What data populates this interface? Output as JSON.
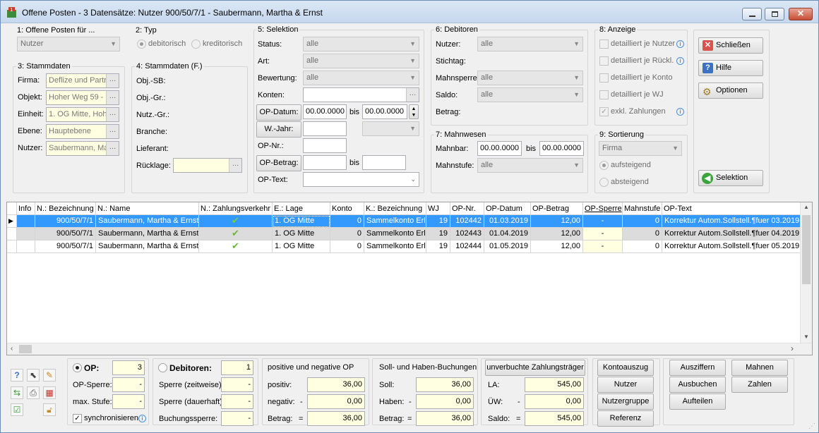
{
  "window": {
    "title": "Offene Posten - 3 Datensätze:  Nutzer 900/50/7/1 - Saubermann, Martha & Ernst",
    "minimize_label": "▬",
    "maximize_label": "▢",
    "close_label": "✕"
  },
  "g1": {
    "title": "1: Offene Posten für ...",
    "value": "Nutzer"
  },
  "g2": {
    "title": "2: Typ",
    "opt1": "debitorisch",
    "opt2": "kreditorisch"
  },
  "g3": {
    "title": "3: Stammdaten",
    "rows": [
      {
        "label": "Firma:",
        "value": "Deflize und Partr"
      },
      {
        "label": "Objekt:",
        "value": "Hoher Weg 59 - "
      },
      {
        "label": "Einheit:",
        "value": "1. OG Mitte, Hoh"
      },
      {
        "label": "Ebene:",
        "value": "Hauptebene"
      },
      {
        "label": "Nutzer:",
        "value": "Saubermann, Ma"
      }
    ]
  },
  "g4": {
    "title": "4: Stammdaten (F.)",
    "labels": [
      "Obj.-SB:",
      "Obj.-Gr.:",
      "Nutz.-Gr.:",
      "Branche:",
      "Lieferant:",
      "Rücklage:"
    ]
  },
  "g5": {
    "title": "5: Selektion",
    "status_label": "Status:",
    "status_value": "alle",
    "art_label": "Art:",
    "art_value": "alle",
    "bewertung_label": "Bewertung:",
    "bewertung_value": "alle",
    "konten_label": "Konten:",
    "opdatum_btn": "OP-Datum:",
    "opdatum_from": "00.00.0000",
    "bis1": "bis",
    "opdatum_to": "00.00.0000",
    "wjahr_btn": "W.-Jahr:",
    "opnr_label": "OP-Nr.:",
    "opbetrag_btn": "OP-Betrag:",
    "bis2": "bis",
    "optext_label": "OP-Text:"
  },
  "g6": {
    "title": "6: Debitoren",
    "nutzer_label": "Nutzer:",
    "nutzer_value": "alle",
    "stichtag_label": "Stichtag:",
    "mahnsperre_label": "Mahnsperre:",
    "mahnsperre_value": "alle",
    "saldo_label": "Saldo:",
    "saldo_value": "alle",
    "betrag_label": "Betrag:"
  },
  "g7": {
    "title": "7: Mahnwesen",
    "mahnbar_label": "Mahnbar:",
    "mahnbar_from": "00.00.0000",
    "bis": "bis",
    "mahnbar_to": "00.00.0000",
    "mahnstufe_label": "Mahnstufe:",
    "mahnstufe_value": "alle"
  },
  "g8": {
    "title": "8: Anzeige",
    "items": [
      "detailliert je Nutzer",
      "detailliert je Rückl.",
      "detailliert je Konto",
      "detailliert je WJ",
      "exkl. Zahlungen"
    ]
  },
  "g9": {
    "title": "9: Sortierung",
    "value": "Firma",
    "opt1": "aufsteigend",
    "opt2": "absteigend"
  },
  "side_buttons": {
    "close": "Schließen",
    "help": "Hilfe",
    "options": "Optionen",
    "selection": "Selektion"
  },
  "grid": {
    "columns": [
      "Info",
      "N.: Bezeichnung",
      "N.: Name",
      "N.: Zahlungsverkehr",
      "E.: Lage",
      "Konto",
      "K.: Bezeichnung",
      "WJ",
      "OP-Nr.",
      "OP-Datum",
      "OP-Betrag",
      "OP-Sperre",
      "Mahnstufe",
      "OP-Text"
    ],
    "rows": [
      {
        "bez": "900/50/7/1",
        "name": "Saubermann, Martha & Ernst",
        "lage": "1. OG Mitte",
        "konto": "0",
        "kbez": "Sammelkonto Erlö",
        "wj": "19",
        "opnr": "102442",
        "datum": "01.03.2019",
        "betrag": "12,00",
        "sperre": "-",
        "mahn": "0",
        "text": "Korrektur Autom.Sollstell.¶fuer 03.2019"
      },
      {
        "bez": "900/50/7/1",
        "name": "Saubermann, Martha & Ernst",
        "lage": "1. OG Mitte",
        "konto": "0",
        "kbez": "Sammelkonto Erlö",
        "wj": "19",
        "opnr": "102443",
        "datum": "01.04.2019",
        "betrag": "12,00",
        "sperre": "-",
        "mahn": "0",
        "text": "Korrektur Autom.Sollstell.¶fuer 04.2019"
      },
      {
        "bez": "900/50/7/1",
        "name": "Saubermann, Martha & Ernst",
        "lage": "1. OG Mitte",
        "konto": "0",
        "kbez": "Sammelkonto Erlö",
        "wj": "19",
        "opnr": "102444",
        "datum": "01.05.2019",
        "betrag": "12,00",
        "sperre": "-",
        "mahn": "0",
        "text": "Korrektur Autom.Sollstell.¶fuer 05.2019"
      }
    ]
  },
  "footer": {
    "op_label": "OP:",
    "op_value": "3",
    "op_sperre_label": "OP-Sperre:",
    "op_sperre_value": "-",
    "max_stufe_label": "max. Stufe:",
    "max_stufe_value": "-",
    "sync_label": "synchronisieren",
    "deb_label": "Debitoren:",
    "deb_value": "1",
    "sperre_zeit_label": "Sperre (zeitweise):",
    "sperre_zeit_value": "-",
    "sperre_dauer_label": "Sperre (dauerhaft):",
    "sperre_dauer_value": "-",
    "buchung_label": "Buchungssperre:",
    "buchung_value": "-",
    "posneg_title": "positive und negative OP",
    "positiv_label": "positiv:",
    "positiv_value": "36,00",
    "negativ_label": "negativ:",
    "negativ_sign": "-",
    "negativ_value": "0,00",
    "betrag_label": "Betrag:",
    "betrag_sign": "=",
    "betrag_value": "36,00",
    "sh_title": "Soll- und Haben-Buchungen",
    "soll_label": "Soll:",
    "soll_value": "36,00",
    "haben_label": "Haben:",
    "haben_sign": "-",
    "haben_value": "0,00",
    "sh_betrag_label": "Betrag:",
    "sh_betrag_sign": "=",
    "sh_betrag_value": "36,00",
    "unverbucht_btn": "unverbuchte Zahlungsträger",
    "la_label": "LA:",
    "la_value": "545,00",
    "uew_label": "ÜW:",
    "uew_sign": "-",
    "uew_value": "0,00",
    "saldo_label": "Saldo:",
    "saldo_sign": "=",
    "saldo_value": "545,00",
    "btn_kontoauszug": "Kontoauszug",
    "btn_nutzer": "Nutzer",
    "btn_nutzergruppe": "Nutzergruppe",
    "btn_referenz": "Referenz",
    "btn_ausziffern": "Ausziffern",
    "btn_ausbuchen": "Ausbuchen",
    "btn_aufteilen": "Aufteilen",
    "btn_mahnen": "Mahnen",
    "btn_zahlen": "Zahlen"
  }
}
